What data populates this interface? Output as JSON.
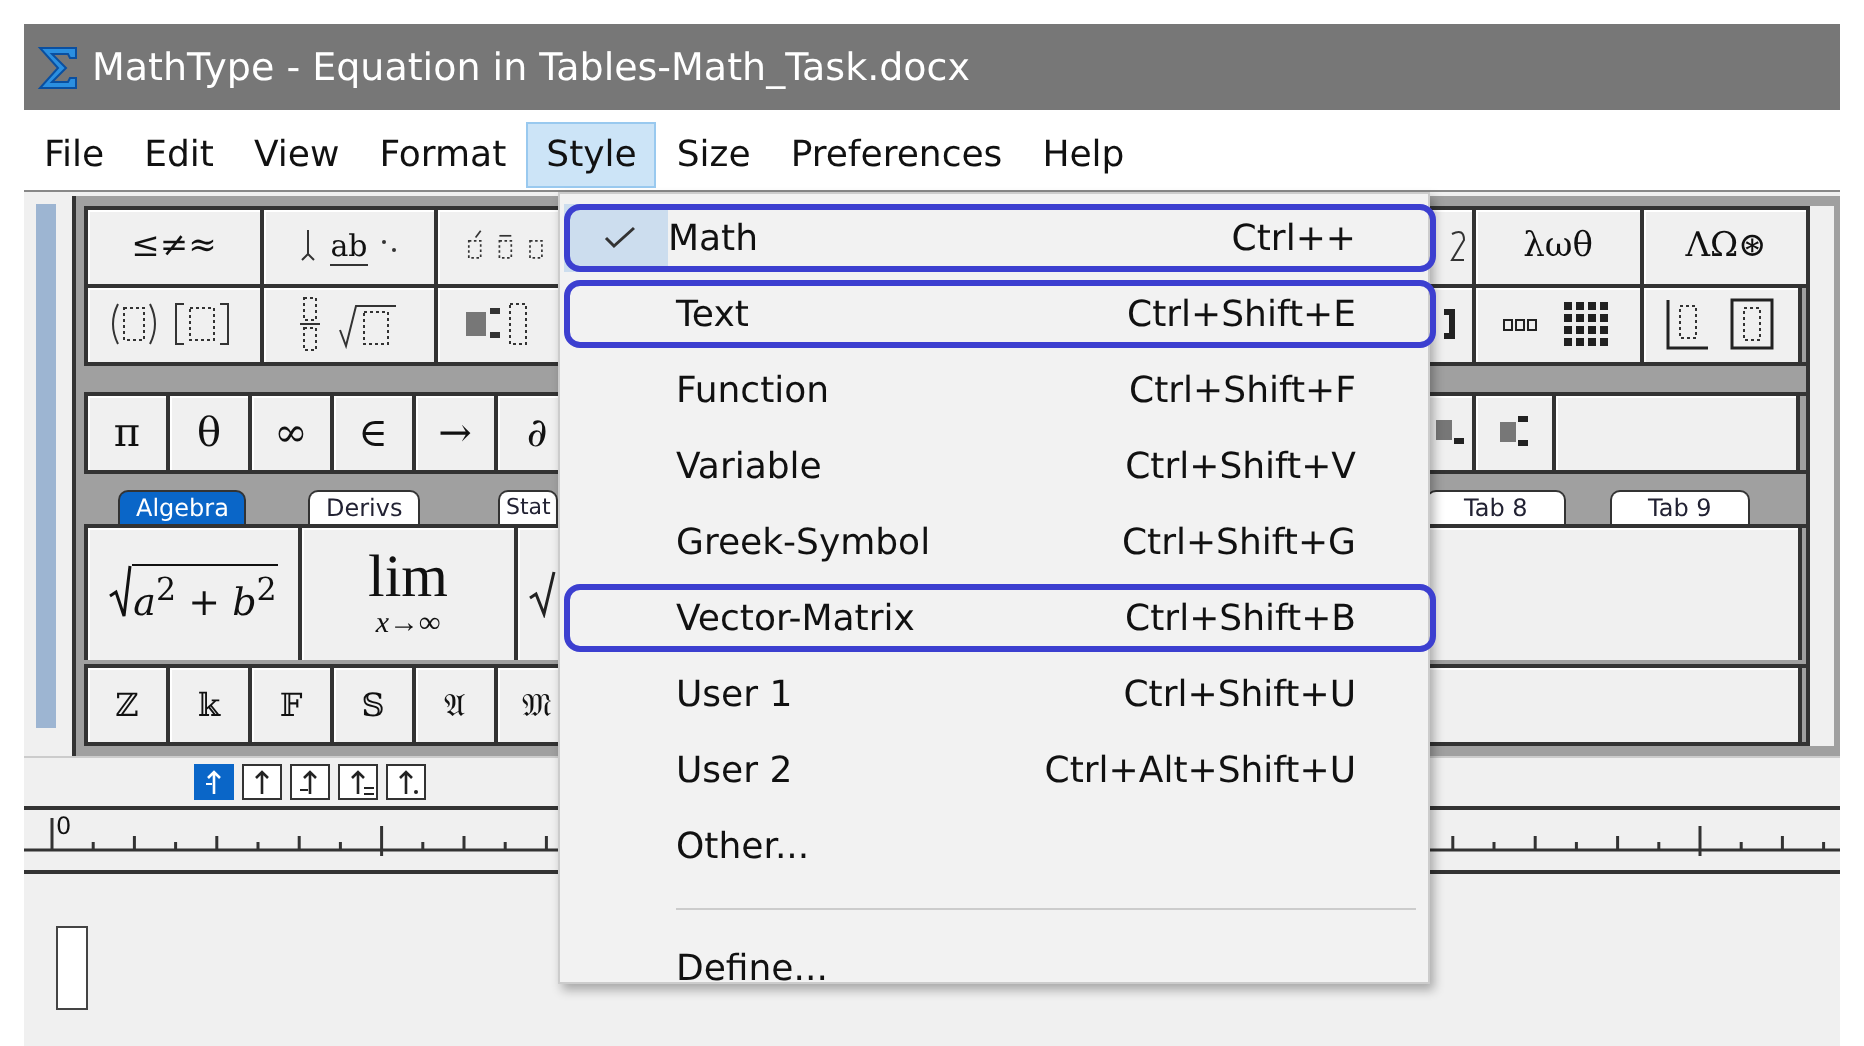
{
  "window": {
    "title": "MathType - Equation in Tables-Math_Task.docx"
  },
  "menu_bar": [
    {
      "label": "File",
      "selected": false
    },
    {
      "label": "Edit",
      "selected": false
    },
    {
      "label": "View",
      "selected": false
    },
    {
      "label": "Format",
      "selected": false
    },
    {
      "label": "Style",
      "selected": true
    },
    {
      "label": "Size",
      "selected": false
    },
    {
      "label": "Preferences",
      "selected": false
    },
    {
      "label": "Help",
      "selected": false
    }
  ],
  "palette": {
    "row_1": {
      "left": [
        "≤≠≈"
      ],
      "under_over": "ab",
      "right": [
        "λωθ",
        "ΛΩ⊛"
      ]
    },
    "symbols": [
      "π",
      "θ",
      "∞",
      "∈",
      "→",
      "∂"
    ],
    "tabs": [
      {
        "label": "Algebra",
        "selected": true
      },
      {
        "label": "Derivs",
        "selected": false
      },
      {
        "label": "Stat",
        "selected": false
      },
      {
        "label": "Tab 8",
        "selected": false
      },
      {
        "label": "Tab 9",
        "selected": false
      }
    ],
    "templates": [
      {
        "kind": "radical",
        "text": "*a*$^{2}$ + *b*$^{2}$"
      },
      {
        "kind": "limit",
        "text": "lim",
        "below": "x→∞"
      }
    ],
    "fonts": [
      "ℤ",
      "𝕜",
      "𝔽",
      "𝕊",
      "𝔄",
      "𝔐"
    ]
  },
  "nudge_buttons": [
    {
      "selected": true
    },
    {
      "selected": false
    },
    {
      "selected": false
    },
    {
      "selected": false
    },
    {
      "selected": false
    }
  ],
  "ruler": {
    "origin": "0"
  },
  "style_menu": {
    "groups": [
      [
        {
          "label": "Math",
          "shortcut": "Ctrl++",
          "checked": true,
          "circled": true
        },
        {
          "label": "Text",
          "shortcut": "Ctrl+Shift+E",
          "checked": false,
          "circled": true
        },
        {
          "label": "Function",
          "shortcut": "Ctrl+Shift+F",
          "checked": false,
          "circled": false
        },
        {
          "label": "Variable",
          "shortcut": "Ctrl+Shift+V",
          "checked": false,
          "circled": false
        },
        {
          "label": "Greek-Symbol",
          "shortcut": "Ctrl+Shift+G",
          "checked": false,
          "circled": false
        },
        {
          "label": "Vector-Matrix",
          "shortcut": "Ctrl+Shift+B",
          "checked": false,
          "circled": true
        },
        {
          "label": "User 1",
          "shortcut": "Ctrl+Shift+U",
          "checked": false,
          "circled": false
        },
        {
          "label": "User 2",
          "shortcut": "Ctrl+Alt+Shift+U",
          "checked": false,
          "circled": false
        },
        {
          "label": "Other...",
          "checked": false,
          "circled": false
        }
      ],
      [
        {
          "label": "Define...",
          "checked": false,
          "circled": false
        }
      ]
    ]
  }
}
